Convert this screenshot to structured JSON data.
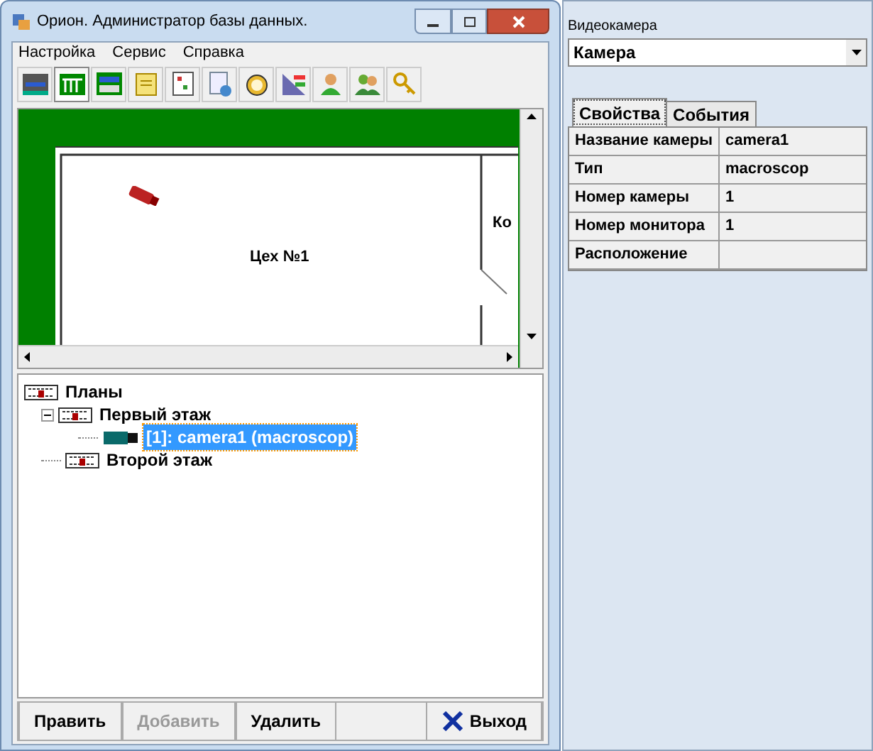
{
  "window": {
    "title": "Орион. Администратор базы данных."
  },
  "menu": [
    {
      "label": "Настройка"
    },
    {
      "label": "Сервис"
    },
    {
      "label": "Справка"
    }
  ],
  "toolbar": [
    {
      "selected": false
    },
    {
      "selected": true
    },
    {
      "selected": false
    },
    {
      "selected": false
    },
    {
      "selected": false
    },
    {
      "selected": false
    },
    {
      "selected": false
    },
    {
      "selected": false
    },
    {
      "selected": false
    },
    {
      "selected": false
    },
    {
      "selected": false
    }
  ],
  "map": {
    "labels": [
      "Цех №1",
      "Ко"
    ]
  },
  "tree": {
    "label": "Планы",
    "selected": false,
    "children": [
      {
        "label": "Первый этаж",
        "selected": false,
        "expanded": true,
        "children": [
          {
            "label": "[1]: camera1 (macroscop)",
            "selected": true,
            "kind": "camera"
          }
        ]
      },
      {
        "label": "Второй этаж",
        "selected": false
      }
    ]
  },
  "buttons": [
    {
      "label": "Править",
      "disabled": false,
      "kind": "plain"
    },
    {
      "label": "Добавить",
      "disabled": true,
      "kind": "plain"
    },
    {
      "label": "Удалить",
      "disabled": false,
      "kind": "plain"
    },
    {
      "label": "Выход",
      "disabled": false,
      "kind": "exit"
    }
  ],
  "panel": {
    "title": "Видеокамера",
    "dropdown": {
      "value": "Камера"
    },
    "tabs": [
      {
        "label": "Свойства",
        "selected": true
      },
      {
        "label": "События",
        "selected": false
      }
    ],
    "properties": [
      {
        "name": "Название камеры",
        "value": "camera1"
      },
      {
        "name": "Тип",
        "value": "macroscop"
      },
      {
        "name": "Номер камеры",
        "value": "1"
      },
      {
        "name": "Номер монитора",
        "value": "1"
      },
      {
        "name": "Расположение"
      }
    ]
  }
}
